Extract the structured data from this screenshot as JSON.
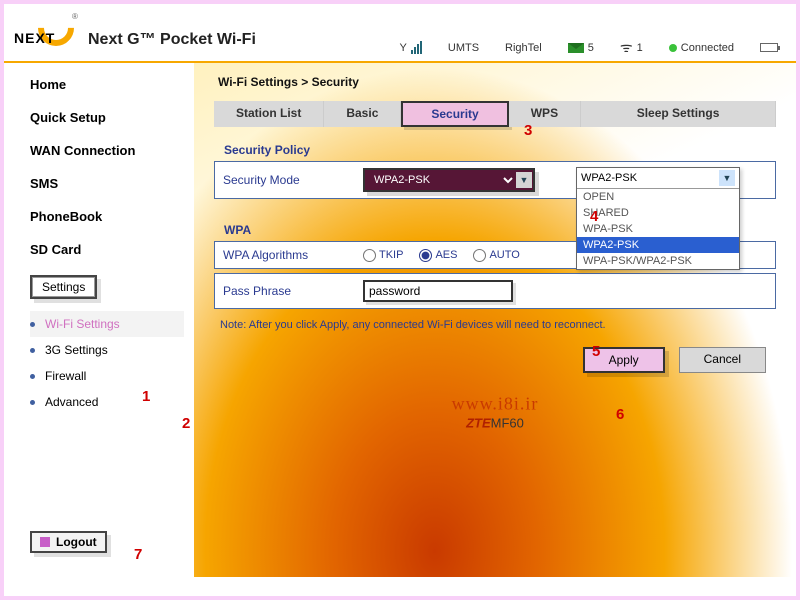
{
  "header": {
    "brand_next": "NEXT",
    "title": "Next G™ Pocket Wi-Fi"
  },
  "status": {
    "network_type": "UMTS",
    "carrier": "RighTel",
    "sms_count": "5",
    "wifi_clients": "1",
    "connection": "Connected"
  },
  "sidebar": {
    "items": [
      {
        "label": "Home"
      },
      {
        "label": "Quick Setup"
      },
      {
        "label": "WAN Connection"
      },
      {
        "label": "SMS"
      },
      {
        "label": "PhoneBook"
      },
      {
        "label": "SD Card"
      }
    ],
    "settings_label": "Settings",
    "sub": [
      {
        "label": "Wi-Fi Settings"
      },
      {
        "label": "3G Settings"
      },
      {
        "label": "Firewall"
      },
      {
        "label": "Advanced"
      }
    ],
    "logout": "Logout"
  },
  "main": {
    "breadcrumb": "Wi-Fi Settings > Security",
    "tabs": [
      {
        "label": "Station List"
      },
      {
        "label": "Basic"
      },
      {
        "label": "Security"
      },
      {
        "label": "WPS"
      },
      {
        "label": "Sleep Settings"
      }
    ],
    "section_security_policy": "Security Policy",
    "security_mode_label": "Security Mode",
    "security_mode_value": "WPA2-PSK",
    "dropdown_options": [
      "OPEN",
      "SHARED",
      "WPA-PSK",
      "WPA2-PSK",
      "WPA-PSK/WPA2-PSK"
    ],
    "section_wpa": "WPA",
    "wpa_alg_label": "WPA Algorithms",
    "wpa_alg_options": [
      "TKIP",
      "AES",
      "AUTO"
    ],
    "wpa_alg_selected": "AES",
    "passphrase_label": "Pass Phrase",
    "passphrase_value": "password",
    "note": "Note: After you click Apply, any connected Wi-Fi devices will need to reconnect.",
    "apply": "Apply",
    "cancel": "Cancel"
  },
  "watermark": {
    "url": "www.i8i.ir",
    "model_brand": "ZTE",
    "model_num": "MF60"
  },
  "annotations": {
    "a1": "1",
    "a2": "2",
    "a3": "3",
    "a4": "4",
    "a5": "5",
    "a6": "6",
    "a7": "7"
  }
}
